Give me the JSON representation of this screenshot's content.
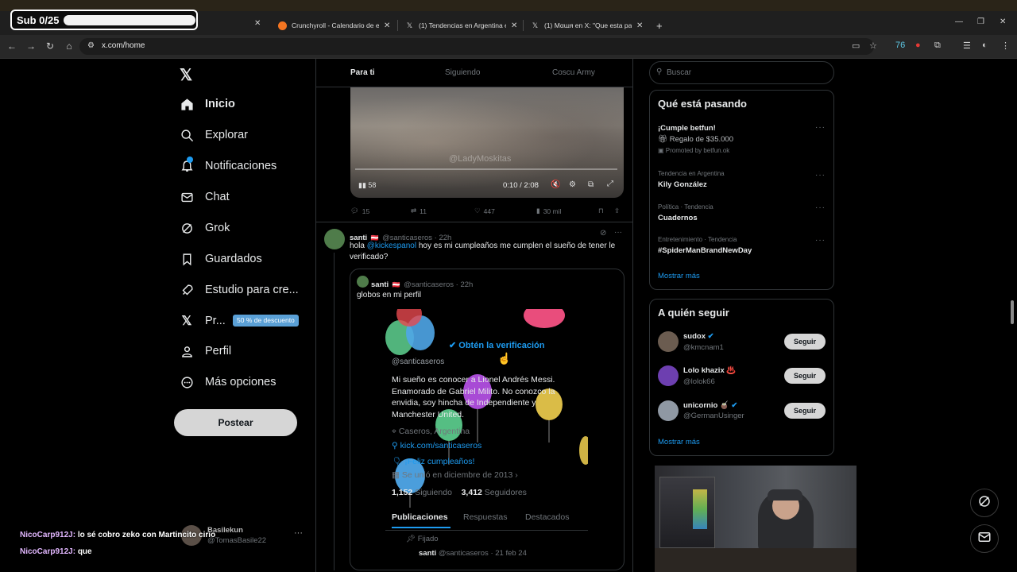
{
  "overlay": {
    "sub_label": "Sub 0/25"
  },
  "browser": {
    "tabs": [
      {
        "title": "Crunchyroll - Calendario de em"
      },
      {
        "title": "(1) Tendencias en Argentina en"
      },
      {
        "title": "(1) Мαɯя en X: \"Que esta pasa"
      }
    ],
    "url": "x.com/home"
  },
  "nav": {
    "items": [
      {
        "label": "Inicio"
      },
      {
        "label": "Explorar"
      },
      {
        "label": "Notificaciones"
      },
      {
        "label": "Chat"
      },
      {
        "label": "Grok"
      },
      {
        "label": "Guardados"
      },
      {
        "label": "Estudio para cre..."
      },
      {
        "label": "Pr..."
      },
      {
        "label": "Perfil"
      },
      {
        "label": "Más opciones"
      }
    ],
    "premium_badge": "50 % de descuento",
    "post_label": "Postear",
    "account_name": "Basilekun",
    "account_handle": "@TomasBasile22"
  },
  "feed": {
    "tabs": [
      "Para ti",
      "Siguiendo",
      "Coscu Army"
    ],
    "video": {
      "time": "0:10 / 2:08",
      "watermark": "@LadyMoskitas",
      "counter": "58"
    },
    "actions": {
      "replies": "15",
      "reposts": "11",
      "likes": "447",
      "views": "30 mil"
    },
    "tweet": {
      "name": "santi",
      "handle": "@santicaseros · 22h",
      "text_prefix": "hola ",
      "mention": "@kickespanol",
      "text_suffix": " hoy es mi cumpleaños me cumplen el sueño de tener le verificado?"
    },
    "quote": {
      "name": "santi",
      "handle": "@santicaseros · 22h",
      "text": "globos en mi perfil",
      "profile": {
        "verify": "Obtén la verificación",
        "handle": "@santicaseros",
        "bio": "Mi sueño es conocer a Lionel Andrés Messi. Enamorado de Gabriel Milito. No conozco la envidia, soy hincha de Independiente y Manchester United.",
        "location": "Caseros, Argentina",
        "link": "kick.com/santicaseros",
        "birthday": "¡Feliz cumpleaños!",
        "joined": "Se unió en diciembre de 2013",
        "following_count": "1,152",
        "following_label": "Siguiendo",
        "followers_count": "3,412",
        "followers_label": "Seguidores",
        "tabs": [
          "Publicaciones",
          "Respuestas",
          "Destacados"
        ],
        "pinned": "Fijado",
        "pinned_author": "santi",
        "pinned_meta": "@santicaseros · 21 feb 24"
      }
    }
  },
  "right": {
    "search_placeholder": "Buscar",
    "trends_title": "Qué está pasando",
    "trends": [
      {
        "title": "¡Cumple betfun!",
        "line2": "Regalo de $35.000",
        "line3": "Promoted by betfun.ok"
      },
      {
        "sub": "Tendencia en Argentina",
        "title": "Kily González"
      },
      {
        "sub": "Política · Tendencia",
        "title": "Cuadernos"
      },
      {
        "sub": "Entretenimiento · Tendencia",
        "title": "#SpiderManBrandNewDay"
      }
    ],
    "trends_more": "Mostrar más",
    "follow_title": "A quién seguir",
    "follow": [
      {
        "name": "sudox",
        "handle": "@kmcnam1",
        "button": "Seguir"
      },
      {
        "name": "Lolo khazix ♨️",
        "handle": "@lolok66",
        "button": "Seguir"
      },
      {
        "name": "unicornio 🧉",
        "handle": "@GermanUsinger",
        "button": "Seguir"
      }
    ],
    "follow_more": "Mostrar más"
  },
  "chat": [
    {
      "user": "NicoCarp912J:",
      "msg": "lo sé cobro zeko con Martincito cirio"
    },
    {
      "user": "NicoCarp912J:",
      "msg": "que"
    }
  ],
  "colors": {
    "accent": "#1d9bf0",
    "border": "#2f3336",
    "muted": "#71767b"
  }
}
